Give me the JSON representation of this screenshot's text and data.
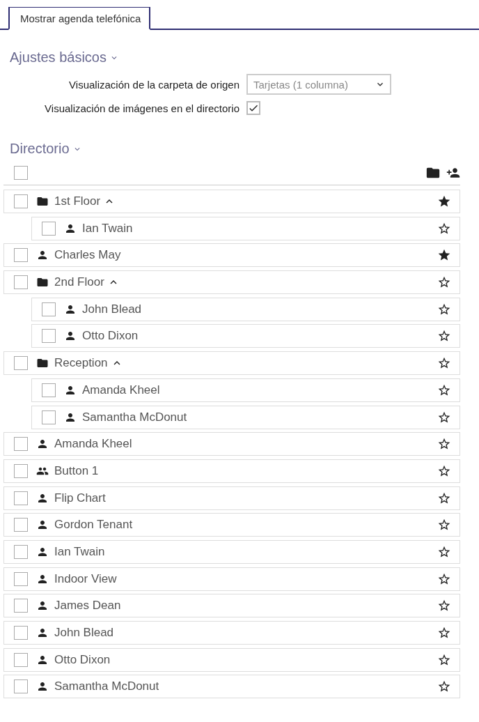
{
  "tabs": [
    {
      "label": "Mostrar agenda telefónica",
      "selected": true
    }
  ],
  "basic_settings": {
    "title": "Ajustes básicos",
    "expanded": true,
    "settings": [
      {
        "kind": "select",
        "label": "Visualización de la carpeta de origen",
        "value": "Tarjetas (1 columna)"
      },
      {
        "kind": "checkbox",
        "label": "Visualización de imágenes en el directorio",
        "checked": true
      }
    ]
  },
  "directory": {
    "title": "Directorio",
    "expanded": true,
    "select_all_checked": false,
    "items": [
      {
        "kind": "folder",
        "name": "1st Floor",
        "checked": false,
        "favorite": true,
        "expanded": true,
        "children": [
          {
            "kind": "person",
            "name": "Ian Twain",
            "checked": false,
            "favorite": false
          }
        ]
      },
      {
        "kind": "person",
        "name": "Charles May",
        "checked": false,
        "favorite": true
      },
      {
        "kind": "folder",
        "name": "2nd Floor",
        "checked": false,
        "favorite": false,
        "expanded": true,
        "children": [
          {
            "kind": "person",
            "name": "John Blead",
            "checked": false,
            "favorite": false
          },
          {
            "kind": "person",
            "name": "Otto Dixon",
            "checked": false,
            "favorite": false
          }
        ]
      },
      {
        "kind": "folder",
        "name": "Reception",
        "checked": false,
        "favorite": false,
        "expanded": true,
        "children": [
          {
            "kind": "person",
            "name": "Amanda Kheel",
            "checked": false,
            "favorite": false
          },
          {
            "kind": "person",
            "name": "Samantha McDonut",
            "checked": false,
            "favorite": false
          }
        ]
      },
      {
        "kind": "person",
        "name": "Amanda Kheel",
        "checked": false,
        "favorite": false
      },
      {
        "kind": "group",
        "name": "Button 1",
        "checked": false,
        "favorite": false
      },
      {
        "kind": "person",
        "name": "Flip Chart",
        "checked": false,
        "favorite": false
      },
      {
        "kind": "person",
        "name": "Gordon Tenant",
        "checked": false,
        "favorite": false
      },
      {
        "kind": "person",
        "name": "Ian Twain",
        "checked": false,
        "favorite": false
      },
      {
        "kind": "person",
        "name": "Indoor View",
        "checked": false,
        "favorite": false
      },
      {
        "kind": "person",
        "name": "James Dean",
        "checked": false,
        "favorite": false
      },
      {
        "kind": "person",
        "name": "John Blead",
        "checked": false,
        "favorite": false
      },
      {
        "kind": "person",
        "name": "Otto Dixon",
        "checked": false,
        "favorite": false
      },
      {
        "kind": "person",
        "name": "Samantha McDonut",
        "checked": false,
        "favorite": false
      }
    ]
  }
}
